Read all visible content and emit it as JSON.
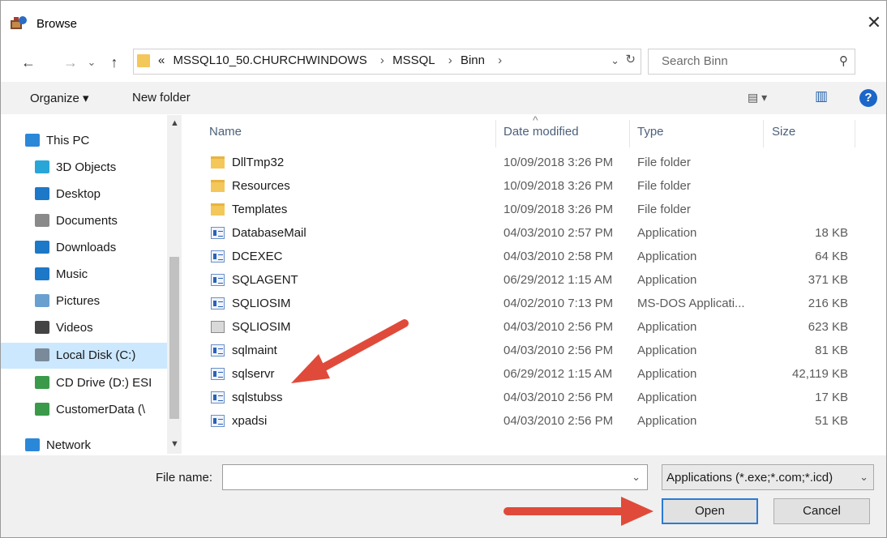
{
  "window": {
    "title": "Browse",
    "close_glyph": "✕"
  },
  "nav_buttons": {
    "back": "←",
    "forward": "→",
    "recent": "⌄",
    "up": "↑"
  },
  "address": {
    "overflow": "«",
    "crumbs": [
      "MSSQL10_50.CHURCHWINDOWS",
      "MSSQL",
      "Binn"
    ],
    "separator": "›",
    "dropdown": "⌄",
    "refresh": "↻"
  },
  "search": {
    "placeholder": "Search Binn",
    "icon": "⚲"
  },
  "toolbar": {
    "organize": "Organize ▾",
    "new_folder": "New folder",
    "view_icon": "▤ ▾",
    "preview_icon": "▥",
    "help": "?"
  },
  "nav_pane": {
    "items": [
      {
        "label": "This PC",
        "icon": "pc-icon",
        "color": "#2b88d8"
      },
      {
        "label": "3D Objects",
        "icon": "cube-icon",
        "color": "#28a6d8"
      },
      {
        "label": "Desktop",
        "icon": "desktop-icon",
        "color": "#1e78c8"
      },
      {
        "label": "Documents",
        "icon": "document-icon",
        "color": "#8a8a8a"
      },
      {
        "label": "Downloads",
        "icon": "download-icon",
        "color": "#1e78c8"
      },
      {
        "label": "Music",
        "icon": "music-icon",
        "color": "#1e78c8"
      },
      {
        "label": "Pictures",
        "icon": "pictures-icon",
        "color": "#6aa0d0"
      },
      {
        "label": "Videos",
        "icon": "videos-icon",
        "color": "#444444"
      },
      {
        "label": "Local Disk (C:)",
        "icon": "disk-icon",
        "color": "#7a8a9a"
      },
      {
        "label": "CD Drive (D:) ESI",
        "icon": "cd-drive-icon",
        "color": "#3a9a4a"
      },
      {
        "label": "CustomerData (\\",
        "icon": "network-drive-icon",
        "color": "#3a9a4a"
      },
      {
        "label": "Network",
        "icon": "network-icon",
        "color": "#2b88d8"
      }
    ],
    "selected_index": 8
  },
  "columns": {
    "name": "Name",
    "date": "Date modified",
    "type": "Type",
    "size": "Size"
  },
  "files": [
    {
      "name": "DllTmp32",
      "date": "10/09/2018 3:26 PM",
      "type": "File folder",
      "size": "",
      "kind": "folder"
    },
    {
      "name": "Resources",
      "date": "10/09/2018 3:26 PM",
      "type": "File folder",
      "size": "",
      "kind": "folder"
    },
    {
      "name": "Templates",
      "date": "10/09/2018 3:26 PM",
      "type": "File folder",
      "size": "",
      "kind": "folder"
    },
    {
      "name": "DatabaseMail",
      "date": "04/03/2010 2:57 PM",
      "type": "Application",
      "size": "18 KB",
      "kind": "app"
    },
    {
      "name": "DCEXEC",
      "date": "04/03/2010 2:58 PM",
      "type": "Application",
      "size": "64 KB",
      "kind": "app"
    },
    {
      "name": "SQLAGENT",
      "date": "06/29/2012 1:15 AM",
      "type": "Application",
      "size": "371 KB",
      "kind": "app"
    },
    {
      "name": "SQLIOSIM",
      "date": "04/02/2010 7:13 PM",
      "type": "MS-DOS Applicati...",
      "size": "216 KB",
      "kind": "app"
    },
    {
      "name": "SQLIOSIM",
      "date": "04/03/2010 2:56 PM",
      "type": "Application",
      "size": "623 KB",
      "kind": "setup"
    },
    {
      "name": "sqlmaint",
      "date": "04/03/2010 2:56 PM",
      "type": "Application",
      "size": "81 KB",
      "kind": "app"
    },
    {
      "name": "sqlservr",
      "date": "06/29/2012 1:15 AM",
      "type": "Application",
      "size": "42,119 KB",
      "kind": "app"
    },
    {
      "name": "sqlstubss",
      "date": "04/03/2010 2:56 PM",
      "type": "Application",
      "size": "17 KB",
      "kind": "app"
    },
    {
      "name": "xpadsi",
      "date": "04/03/2010 2:56 PM",
      "type": "Application",
      "size": "51 KB",
      "kind": "app"
    }
  ],
  "bottom": {
    "file_name_label": "File name:",
    "file_name_value": "",
    "filter": "Applications (*.exe;*.com;*.icd)",
    "open": "Open",
    "cancel": "Cancel"
  },
  "annotation_color": "#e04a3a"
}
